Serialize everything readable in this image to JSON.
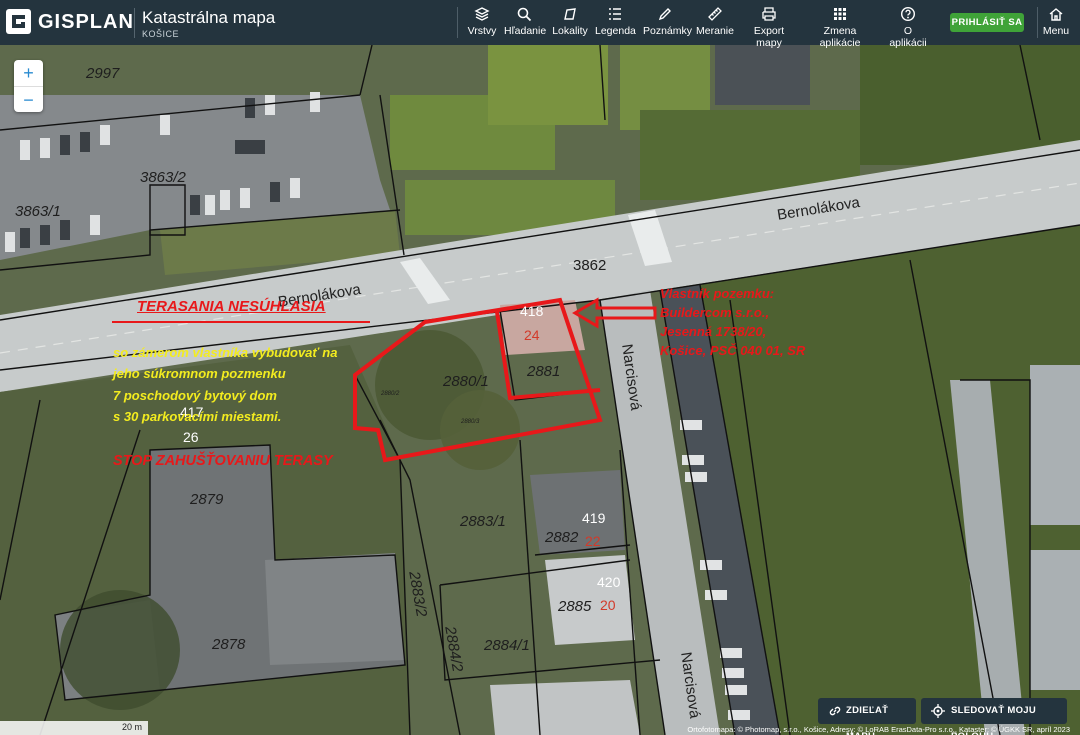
{
  "header": {
    "brand": "GISPLAN",
    "title": "Katastrálna mapa",
    "subtitle": "KOŠICE",
    "nav": [
      {
        "label": "Vrstvy",
        "icon": "layers-icon"
      },
      {
        "label": "Hľadanie",
        "icon": "search-icon"
      },
      {
        "label": "Lokality",
        "icon": "location-icon"
      },
      {
        "label": "Legenda",
        "icon": "list-icon"
      },
      {
        "label": "Poznámky",
        "icon": "pencil-icon"
      },
      {
        "label": "Meranie",
        "icon": "ruler-icon"
      },
      {
        "label": "Export mapy",
        "icon": "printer-icon"
      },
      {
        "label": "Zmena aplikácie",
        "icon": "grid-icon"
      },
      {
        "label": "O aplikácii",
        "icon": "help-icon"
      }
    ],
    "login": "PRIHLÁSIŤ SA",
    "menu": "Menu"
  },
  "map": {
    "zoom_in": "+",
    "zoom_out": "−",
    "parcels": [
      "2997",
      "3863/2",
      "3863/1",
      "3862",
      "2880/1",
      "2881",
      "2879",
      "2878",
      "2883/1",
      "2882",
      "2883/2",
      "2885",
      "2884/2",
      "2884/1",
      "2880/2",
      "2880/3"
    ],
    "house_numbers": [
      {
        "n": "418",
        "c": "24"
      },
      {
        "n": "417",
        "c": "26"
      },
      {
        "n": "419",
        "c": "22"
      },
      {
        "n": "420",
        "c": "20"
      }
    ],
    "streets": [
      "Bernolákova",
      "Bernolákova",
      "Narcisová",
      "Narcisová"
    ],
    "annotations": {
      "headline": "TERASANIA NESÚHLASIA",
      "yellow": [
        "so zámerom vlastníka vybudovať na",
        "jeho súkromnom pozmenku",
        "7 poschodový bytový dom",
        "s 30 parkovacími miestami."
      ],
      "owner": [
        "Vlastník pozemku:",
        "Buildercom s.r.o.,",
        "Jesenná 1738/20,",
        "Košice, PSČ 040 01, SR"
      ],
      "stop": "STOP ZAHUŠŤOVANIU TERASY"
    },
    "accent_colors": {
      "annotation_red": "#e8181a",
      "annotation_yellow": "#f3ec1f",
      "topbar": "#24343e",
      "login_green": "#3fa338"
    }
  },
  "footer": {
    "share": "ZDIEĽAŤ MAPU",
    "track": "SLEDOVAŤ MOJU POLOHU",
    "scale": "20 m",
    "attribution": "Ortofotomapa: © Photomap, s.r.o., Košice, Adresy: © LoRAB ErasData-Pro s.r.o., Kataster: © ÚGKK SR, apríl 2023"
  }
}
